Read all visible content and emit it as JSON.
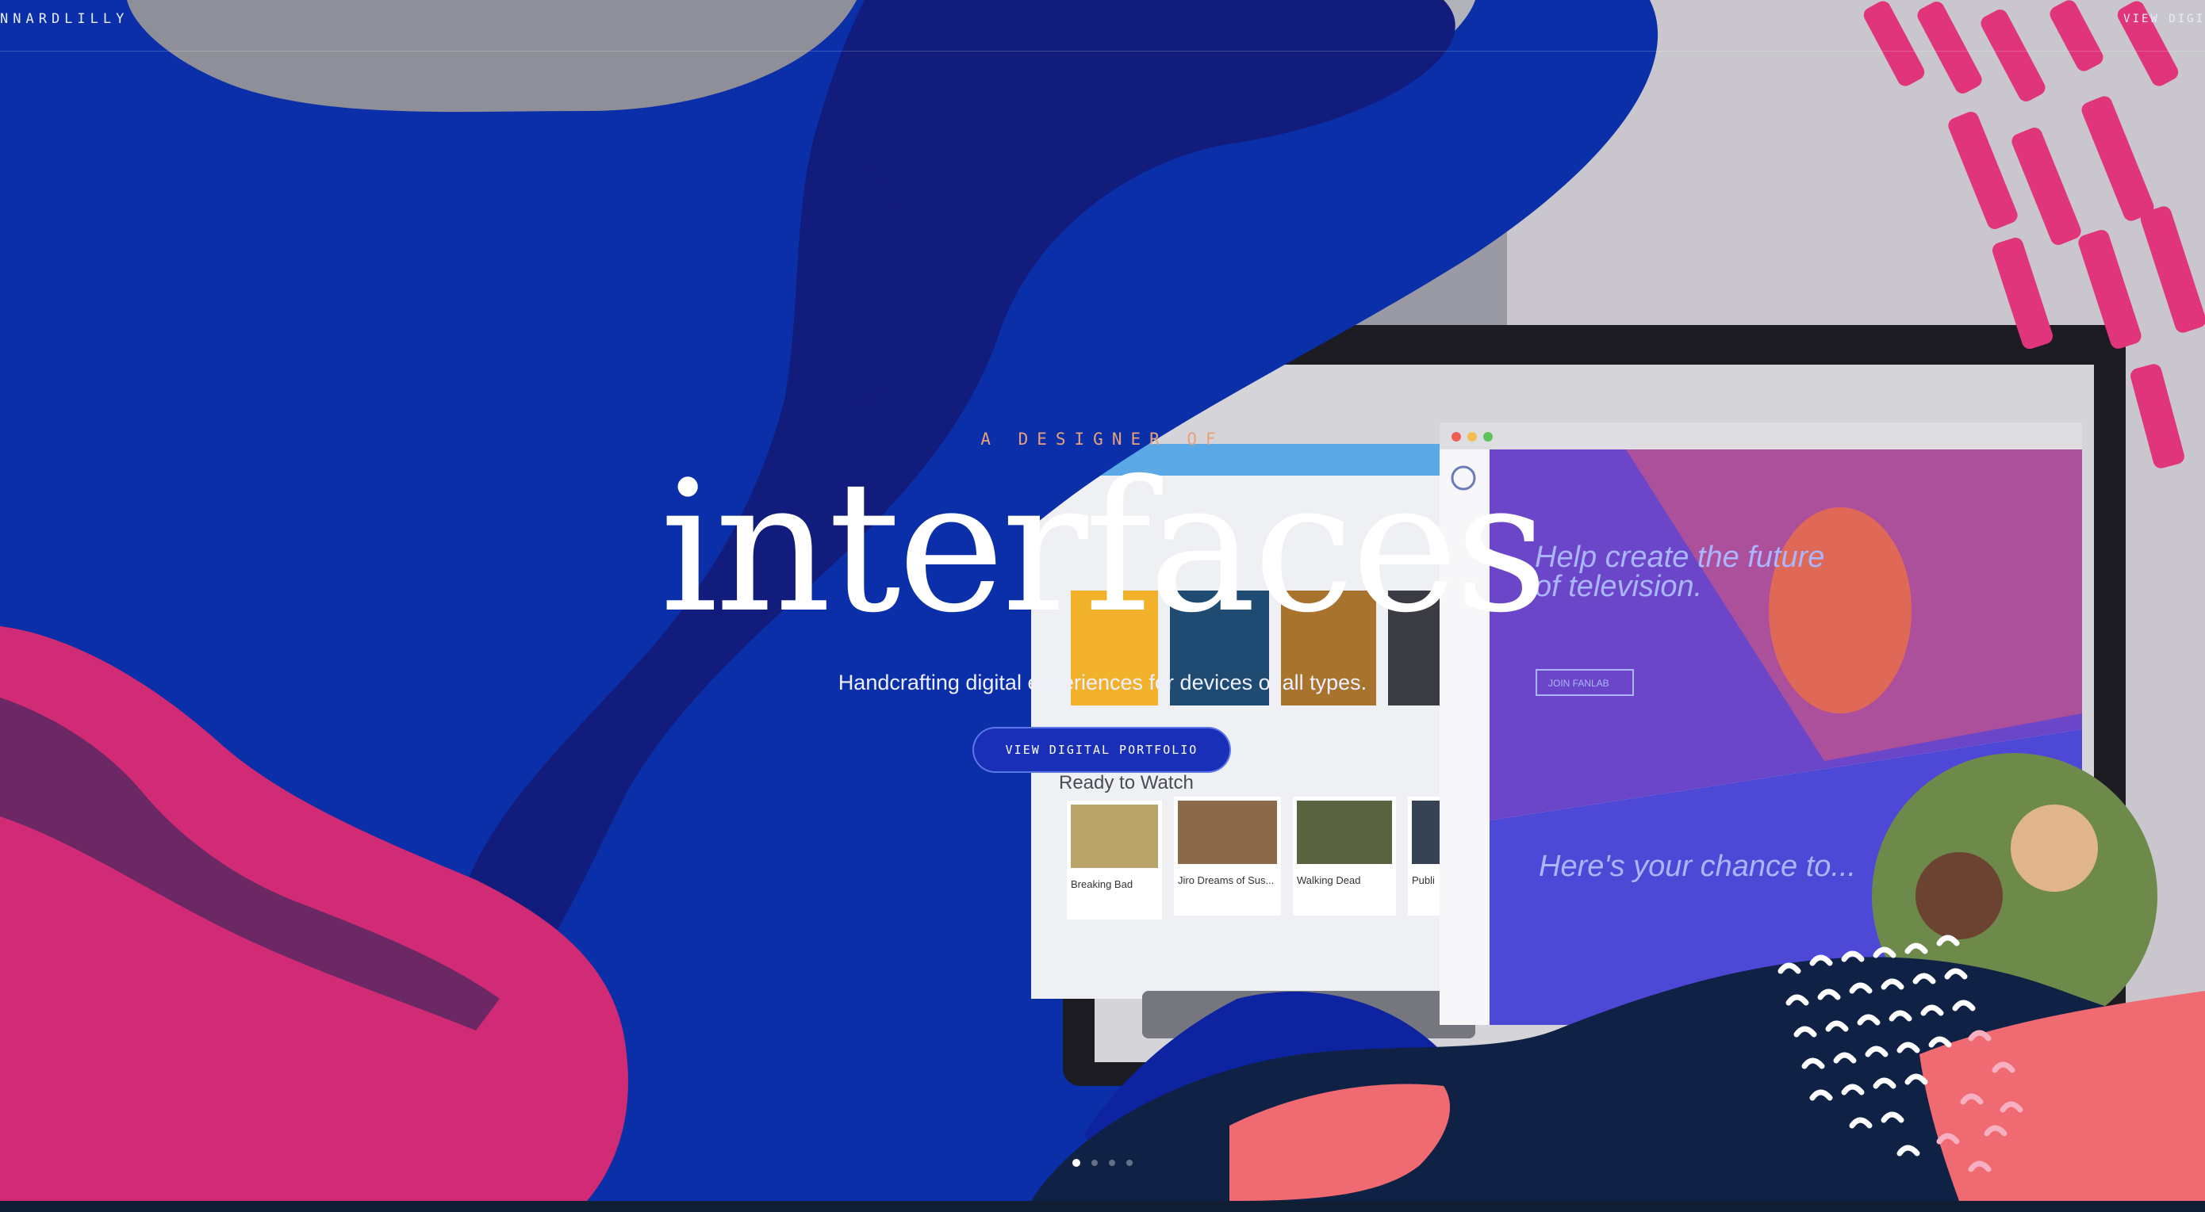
{
  "header": {
    "logo_text": "NNARDLILLY",
    "nav_link": "VIEW DIGI"
  },
  "hero": {
    "eyebrow": "A DESIGNER OF",
    "headline": "interfaces",
    "subline": "Handcrafting digital experiences for devices of all types.",
    "cta_label": "VIEW DIGITAL PORTFOLIO"
  },
  "carousel": {
    "slides": 4,
    "active_index": 0
  },
  "screen_left": {
    "row_heading": "Ready to Watch",
    "tiles": [
      "Breaking Bad",
      "Jiro Dreams of Sus...",
      "Walking Dead",
      "Publi"
    ]
  },
  "screen_right": {
    "title_line_1": "Help create the future",
    "title_line_2": "of television.",
    "button_label": "JOIN FANLAB",
    "second_heading": "Here's your chance to..."
  },
  "colors": {
    "navy": "#121c7c",
    "blue": "#0a2fa8",
    "pink": "#d02b74",
    "coral": "#f06a72",
    "accent_orange": "#e8a27a"
  }
}
